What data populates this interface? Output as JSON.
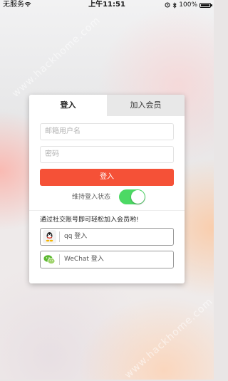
{
  "status_bar": {
    "carrier": "无服务",
    "time": "上午11:51",
    "battery_percent": "100%",
    "battery_level": 1.0
  },
  "watermarks": [
    "www.hackhome.com",
    "www.hackhome.com"
  ],
  "tabs": [
    {
      "label": "登入",
      "active": true
    },
    {
      "label": "加入会员",
      "active": false
    }
  ],
  "form": {
    "email_placeholder": "邮箱用户名",
    "password_placeholder": "密码",
    "login_button": "登入",
    "remember_label": "维持登入状态",
    "remember_on": true
  },
  "social": {
    "title": "通过社交账号即可轻松加入会员哟!",
    "qq_label": "qq 登入",
    "wechat_label": "WeChat 登入"
  },
  "colors": {
    "accent": "#f55137",
    "toggle_on": "#4cd964"
  },
  "icons": [
    "wifi-icon",
    "alarm-icon",
    "bluetooth-icon",
    "battery-icon",
    "qq-icon",
    "wechat-icon"
  ]
}
